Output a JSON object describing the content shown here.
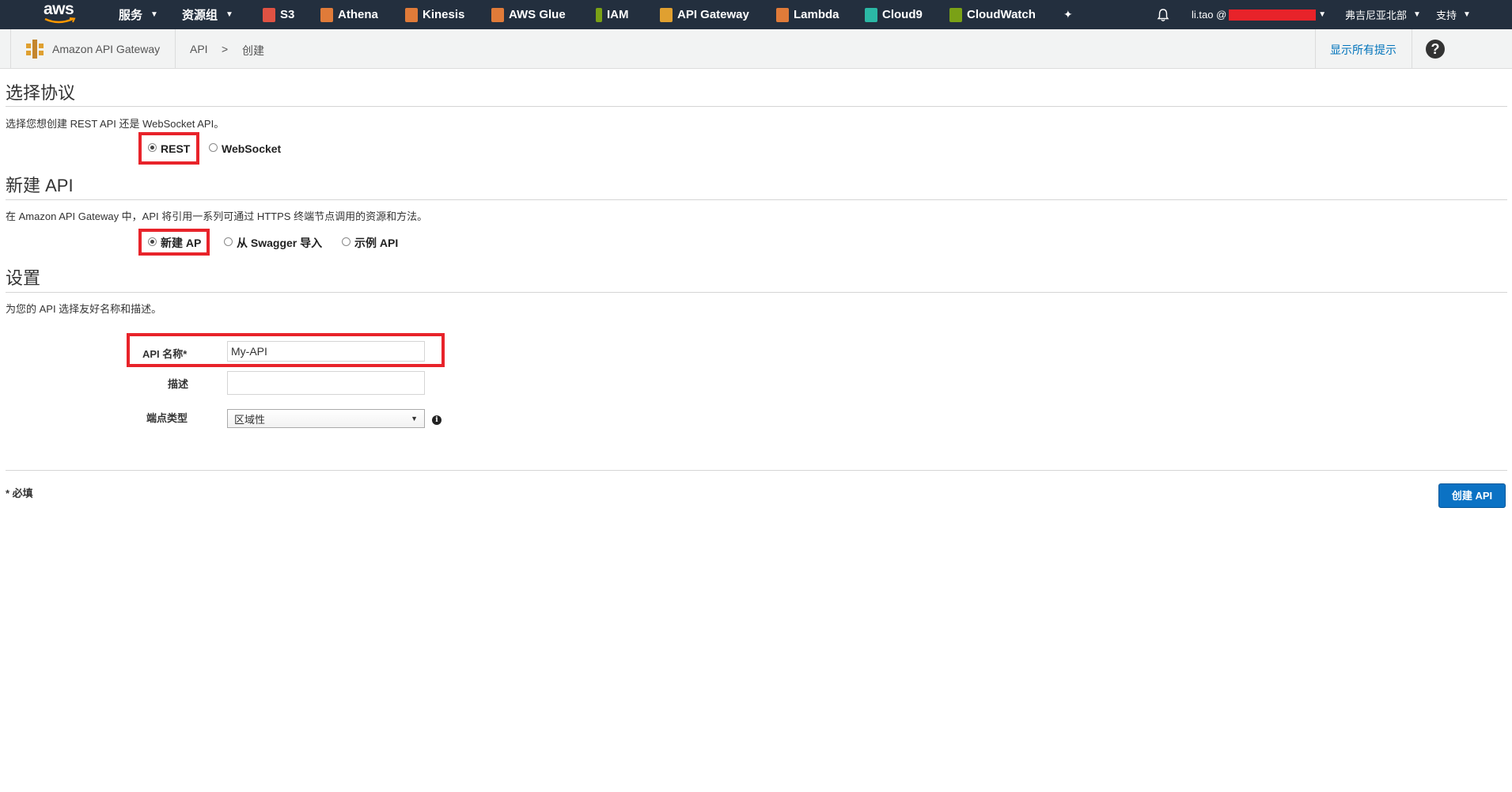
{
  "topnav": {
    "logo_text": "aws",
    "services_label": "服务",
    "resource_groups_label": "资源组",
    "shortcuts": [
      {
        "label": "S3",
        "icon": "s3-icon",
        "color": "#e05243"
      },
      {
        "label": "Athena",
        "icon": "athena-icon",
        "color": "#e07b39"
      },
      {
        "label": "Kinesis",
        "icon": "kinesis-icon",
        "color": "#e07b39"
      },
      {
        "label": "AWS Glue",
        "icon": "glue-icon",
        "color": "#e07b39"
      },
      {
        "label": "IAM",
        "icon": "iam-icon",
        "color": "#7aa116"
      },
      {
        "label": "API Gateway",
        "icon": "api-gateway-icon",
        "color": "#e0a030"
      },
      {
        "label": "Lambda",
        "icon": "lambda-icon",
        "color": "#e07b39"
      },
      {
        "label": "Cloud9",
        "icon": "cloud9-icon",
        "color": "#2bb8a5"
      },
      {
        "label": "CloudWatch",
        "icon": "cloudwatch-icon",
        "color": "#7aa116"
      }
    ],
    "user_label": "li.tao @",
    "region_label": "弗吉尼亚北部",
    "support_label": "支持"
  },
  "subheader": {
    "service_name": "Amazon API Gateway",
    "breadcrumb": [
      "API",
      ">",
      "创建"
    ],
    "show_hints": "显示所有提示",
    "help": "?"
  },
  "protocol": {
    "title": "选择协议",
    "description": "选择您想创建 REST API 还是 WebSocket API。",
    "options": [
      {
        "label": "REST",
        "selected": true
      },
      {
        "label": "WebSocket",
        "selected": false
      }
    ]
  },
  "new_api": {
    "title": "新建 API",
    "description": "在 Amazon API Gateway 中，API 将引用一系列可通过 HTTPS 终端节点调用的资源和方法。",
    "options": [
      {
        "label": "新建 AP",
        "selected": true
      },
      {
        "label": "从 Swagger 导入",
        "selected": false
      },
      {
        "label": "示例 API",
        "selected": false
      }
    ]
  },
  "settings": {
    "title": "设置",
    "description": "为您的 API 选择友好名称和描述。",
    "api_name_label": "API 名称*",
    "api_name_value": "My-API",
    "description_label": "描述",
    "description_value": "",
    "endpoint_type_label": "端点类型",
    "endpoint_type_value": "区域性",
    "info": "i"
  },
  "footer": {
    "required_note": "* 必填",
    "create_button": "创建 API"
  },
  "colors": {
    "nav_bg": "#232f3e",
    "highlight": "#e8232a",
    "primary": "#0b72c4",
    "link": "#0073bb"
  }
}
